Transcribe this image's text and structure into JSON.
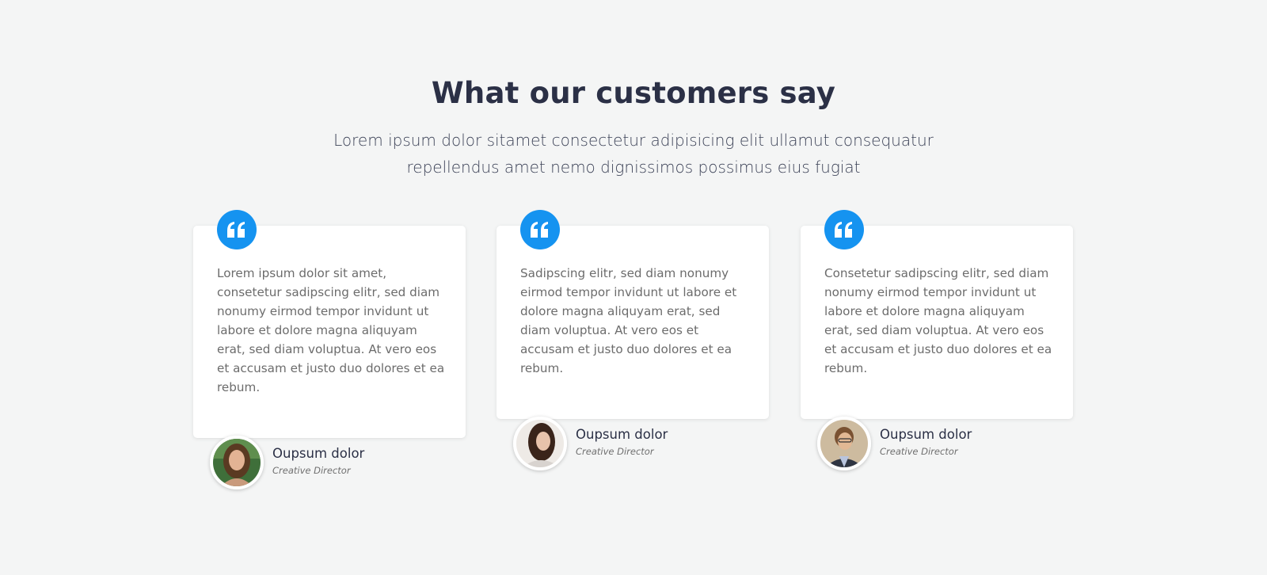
{
  "header": {
    "title": "What our customers say",
    "subtitle_line1": "Lorem ipsum dolor sitamet consectetur adipisicing elit ullamut consequatur",
    "subtitle_line2": "repellendus amet nemo dignissimos possimus eius fugiat"
  },
  "accent_color": "#1593f0",
  "quote_icon": "quote-left-icon",
  "testimonials": [
    {
      "text": "Lorem ipsum dolor sit amet, consetetur sadipscing elitr, sed diam nonumy eirmod tempor invidunt ut labore et dolore magna aliquyam erat, sed diam voluptua. At vero eos et accusam et justo duo dolores et ea rebum.",
      "name": "Oupsum dolor",
      "role": "Creative Director"
    },
    {
      "text": "Sadipscing elitr, sed diam nonumy eirmod tempor invidunt ut labore et dolore magna aliquyam erat, sed diam voluptua. At vero eos et accusam et justo duo dolores et ea rebum.",
      "name": "Oupsum dolor",
      "role": "Creative Director"
    },
    {
      "text": "Consetetur sadipscing elitr, sed diam nonumy eirmod tempor invidunt ut labore et dolore magna aliquyam erat, sed diam voluptua. At vero eos et accusam et justo duo dolores et ea rebum.",
      "name": "Oupsum dolor",
      "role": "Creative Director"
    }
  ]
}
